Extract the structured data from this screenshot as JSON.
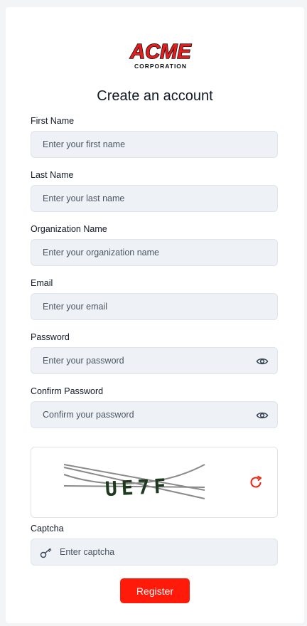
{
  "brand": {
    "logo_top": "ACME",
    "logo_bottom": "CORPORATION"
  },
  "form": {
    "title": "Create an account",
    "first_name": {
      "label": "First Name",
      "placeholder": "Enter your first name",
      "value": ""
    },
    "last_name": {
      "label": "Last Name",
      "placeholder": "Enter your last name",
      "value": ""
    },
    "organization": {
      "label": "Organization Name",
      "placeholder": "Enter your organization name",
      "value": ""
    },
    "email": {
      "label": "Email",
      "placeholder": "Enter your email",
      "value": ""
    },
    "password": {
      "label": "Password",
      "placeholder": "Enter your password",
      "value": ""
    },
    "confirm_password": {
      "label": "Confirm Password",
      "placeholder": "Confirm your password",
      "value": ""
    },
    "captcha": {
      "image_text": "UE7F",
      "label": "Captcha",
      "placeholder": "Enter captcha",
      "value": ""
    },
    "register_label": "Register"
  },
  "icons": {
    "password_toggle": "eye-icon",
    "captcha_refresh": "refresh-icon",
    "captcha_field": "key-icon"
  },
  "colors": {
    "accent": "#ff1a0a",
    "input_bg": "#eef2f6",
    "page_bg": "#f3f4f6"
  }
}
